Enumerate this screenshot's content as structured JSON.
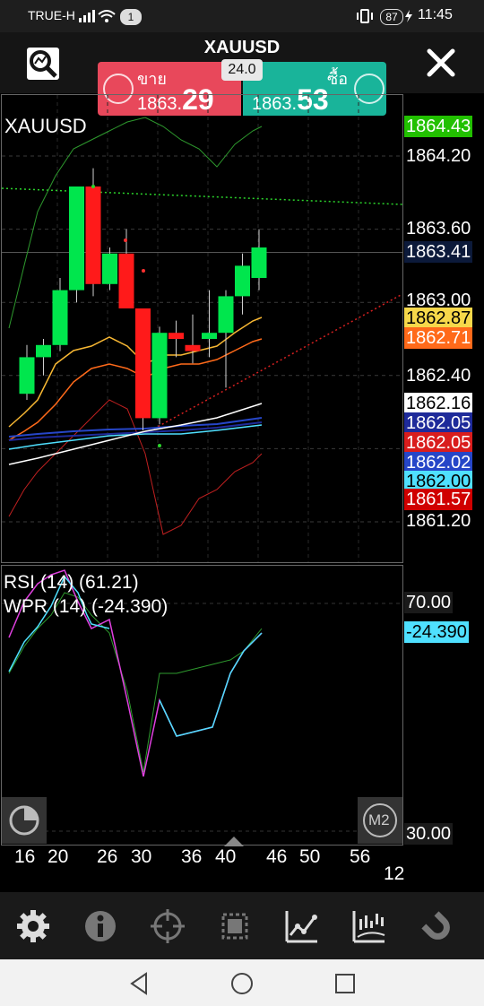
{
  "status_bar": {
    "carrier": "TRUE-H",
    "notification_count": "1",
    "battery": "87",
    "time": "11:45"
  },
  "header": {
    "symbol": "XAUUSD",
    "spread": "24.0",
    "sell": {
      "label": "ขาย",
      "price_small": "1863.",
      "price_big": "29"
    },
    "buy": {
      "label": "ซื้อ",
      "price_small": "1863.",
      "price_big": "53"
    }
  },
  "chart": {
    "symbol_label": "XAUUSD",
    "timeframe_badge": "M2",
    "price_labels": [
      {
        "text": "1864.43",
        "fg": "#ffffff",
        "bg": "#22c000"
      },
      {
        "text": "1864.20",
        "fg": "#ffffff",
        "bg": ""
      },
      {
        "text": "1863.60",
        "fg": "#ffffff",
        "bg": ""
      },
      {
        "text": "1863.41",
        "fg": "#ffffff",
        "bg": "#0c1a3a"
      },
      {
        "text": "1863.00",
        "fg": "#ffffff",
        "bg": ""
      },
      {
        "text": "1862.87",
        "fg": "#000000",
        "bg": "#f7d84a"
      },
      {
        "text": "1862.71",
        "fg": "#ffffff",
        "bg": "#ff6a1a"
      },
      {
        "text": "1862.40",
        "fg": "#ffffff",
        "bg": ""
      },
      {
        "text": "1862.16",
        "fg": "#000000",
        "bg": "#ffffff"
      },
      {
        "text": "1862.05",
        "fg": "#ffffff",
        "bg": "#1e2a9a"
      },
      {
        "text": "1862.05",
        "fg": "#ffffff",
        "bg": "#d91d1d"
      },
      {
        "text": "1862.02",
        "fg": "#ffffff",
        "bg": "#2646c8"
      },
      {
        "text": "1862.00",
        "fg": "#000000",
        "bg": "#4fe0ff"
      },
      {
        "text": "1861.57",
        "fg": "#ffffff",
        "bg": "#d00000"
      },
      {
        "text": "1861.20",
        "fg": "#ffffff",
        "bg": ""
      }
    ],
    "indicator_labels": {
      "rsi": "RSI (14) (61.21)",
      "wpr": "WPR (14) (-24.390)"
    },
    "sub_price_labels": [
      {
        "text": "70.00",
        "fg": "#ffffff",
        "bg": "#1a1a1a"
      },
      {
        "text": "-24.390",
        "fg": "#000000",
        "bg": "#4fe0ff"
      },
      {
        "text": "30.00",
        "fg": "#ffffff",
        "bg": "#1a1a1a"
      }
    ],
    "x_labels": [
      "16",
      "20",
      "26",
      "30",
      "36",
      "40",
      "46",
      "50",
      "56"
    ],
    "hour_label": "12",
    "candles": [
      {
        "o": 1862.25,
        "h": 1862.65,
        "l": 1862.2,
        "c": 1862.55
      },
      {
        "o": 1862.55,
        "h": 1862.7,
        "l": 1862.4,
        "c": 1862.65
      },
      {
        "o": 1862.65,
        "h": 1863.2,
        "l": 1862.6,
        "c": 1863.1
      },
      {
        "o": 1863.1,
        "h": 1863.9,
        "l": 1863.0,
        "c": 1863.95
      },
      {
        "o": 1863.95,
        "h": 1864.1,
        "l": 1863.05,
        "c": 1863.15
      },
      {
        "o": 1863.15,
        "h": 1863.45,
        "l": 1863.1,
        "c": 1863.4
      },
      {
        "o": 1863.4,
        "h": 1863.6,
        "l": 1863.0,
        "c": 1862.95
      },
      {
        "o": 1862.95,
        "h": 1862.95,
        "l": 1861.95,
        "c": 1862.05
      },
      {
        "o": 1862.05,
        "h": 1862.8,
        "l": 1862.0,
        "c": 1862.75
      },
      {
        "o": 1862.75,
        "h": 1862.85,
        "l": 1862.55,
        "c": 1862.7
      },
      {
        "o": 1862.65,
        "h": 1862.9,
        "l": 1862.5,
        "c": 1862.6
      },
      {
        "o": 1862.7,
        "h": 1863.1,
        "l": 1862.55,
        "c": 1862.75
      },
      {
        "o": 1862.75,
        "h": 1863.1,
        "l": 1862.3,
        "c": 1863.05
      },
      {
        "o": 1863.05,
        "h": 1863.4,
        "l": 1862.9,
        "c": 1863.3
      },
      {
        "o": 1863.2,
        "h": 1863.6,
        "l": 1863.1,
        "c": 1863.45
      }
    ],
    "colors": {
      "bull": "#00e64d",
      "bear": "#ff1a1a"
    }
  },
  "toolbar": {
    "icons": [
      "gear-icon",
      "info-icon",
      "crosshair-icon",
      "object-icon",
      "line-chart-icon",
      "indicator-icon",
      "magnet-icon"
    ]
  }
}
